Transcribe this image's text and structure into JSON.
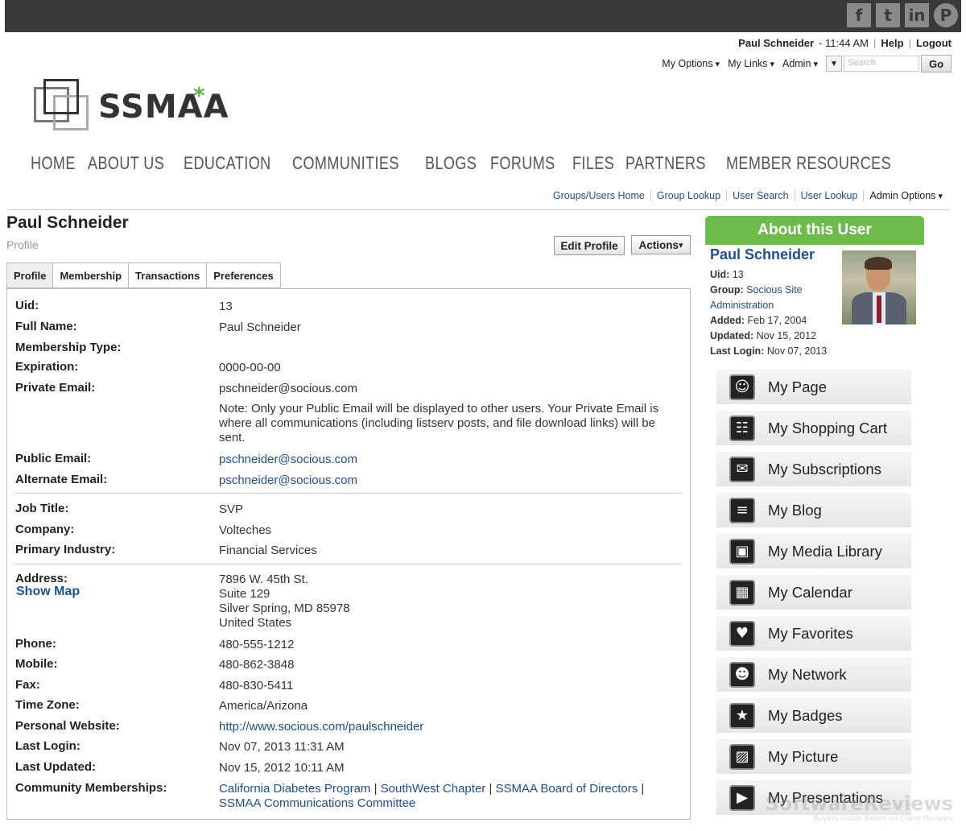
{
  "social": [
    {
      "icon": "facebook-icon",
      "glyph": "f"
    },
    {
      "icon": "twitter-icon",
      "glyph": "t"
    },
    {
      "icon": "linkedin-icon",
      "glyph": "in"
    },
    {
      "icon": "pinterest-icon",
      "glyph": "P"
    }
  ],
  "header": {
    "user_name": "Paul Schneider",
    "time": "- 11:44 AM",
    "help": "Help",
    "logout": "Logout",
    "my_options": "My Options",
    "my_links": "My Links",
    "admin": "Admin",
    "search_placeholder": "Search",
    "go": "Go"
  },
  "logo": {
    "text": "SSMAA",
    "star": "*"
  },
  "nav": [
    "HOME",
    "ABOUT US",
    "EDUCATION",
    "COMMUNITIES",
    "BLOGS",
    "FORUMS",
    "FILES",
    "PARTNERS",
    "MEMBER RESOURCES"
  ],
  "subnav": [
    "Groups/Users Home",
    "Group Lookup",
    "User Search",
    "User Lookup",
    "Admin Options"
  ],
  "page": {
    "title": "Paul Schneider",
    "subtitle": "Profile",
    "edit_profile": "Edit Profile",
    "actions": "Actions"
  },
  "tabs": [
    "Profile",
    "Membership",
    "Transactions",
    "Preferences"
  ],
  "profile": {
    "uid_label": "Uid:",
    "uid": "13",
    "fullname_label": "Full Name:",
    "fullname": "Paul Schneider",
    "membership_label": "Membership Type:",
    "expiration_label": "Expiration:",
    "expiration": "0000-00-00",
    "private_email_label": "Private Email:",
    "private_email": "pschneider@socious.com",
    "note": "Note: Only your Public Email will be displayed to other users. Your Private Email is where all communications (including listserv posts, and file download links) will be sent.",
    "public_email_label": "Public Email:",
    "public_email": "pschneider@socious.com",
    "alt_email_label": "Alternate Email:",
    "alt_email": "pschneider@socious.com",
    "job_label": "Job Title:",
    "job": "SVP",
    "company_label": "Company:",
    "company": "Volteches",
    "industry_label": "Primary Industry:",
    "industry": "Financial Services",
    "address_label": "Address:",
    "show_map": "Show Map",
    "address": [
      "7896 W. 45th St.",
      "Suite 129",
      "Silver Spring, MD 85978",
      "United States"
    ],
    "phone_label": "Phone:",
    "phone": "480-555-1212",
    "mobile_label": "Mobile:",
    "mobile": "480-862-3848",
    "fax_label": "Fax:",
    "fax": "480-830-5411",
    "tz_label": "Time Zone:",
    "tz": "America/Arizona",
    "website_label": "Personal Website:",
    "website": "http://www.socious.com/paulschneider",
    "lastlogin_label": "Last Login:",
    "lastlogin": "Nov 07, 2013 11:31 AM",
    "lastupdated_label": "Last Updated:",
    "lastupdated": "Nov 15, 2012 10:11 AM",
    "communities_label": "Community Memberships:",
    "communities": [
      "California Diabetes Program",
      "SouthWest Chapter",
      "SSMAA Board of Directors",
      "SSMAA Communications Committee"
    ]
  },
  "about": {
    "heading": "About this User",
    "name": "Paul Schneider",
    "uid_label": "Uid:",
    "uid": "13",
    "group_label": "Group:",
    "group": "Socious Site Administration",
    "added_label": "Added:",
    "added": "Feb 17, 2004",
    "updated_label": "Updated:",
    "updated": "Nov 15, 2012",
    "lastlogin_label": "Last Login:",
    "lastlogin": "Nov 07, 2013"
  },
  "menu": [
    {
      "label": "My Page",
      "icon": "user-icon",
      "glyph": "☺"
    },
    {
      "label": "My Shopping Cart",
      "icon": "cart-icon",
      "glyph": "☷"
    },
    {
      "label": "My Subscriptions",
      "icon": "envelope-icon",
      "glyph": "✉"
    },
    {
      "label": "My Blog",
      "icon": "rss-icon",
      "glyph": "≡"
    },
    {
      "label": "My Media Library",
      "icon": "media-icon",
      "glyph": "▣"
    },
    {
      "label": "My Calendar",
      "icon": "calendar-icon",
      "glyph": "▦"
    },
    {
      "label": "My Favorites",
      "icon": "heart-icon",
      "glyph": "♥"
    },
    {
      "label": "My Network",
      "icon": "network-icon",
      "glyph": "☻"
    },
    {
      "label": "My Badges",
      "icon": "badge-icon",
      "glyph": "★"
    },
    {
      "label": "My Picture",
      "icon": "picture-icon",
      "glyph": "▨"
    },
    {
      "label": "My Presentations",
      "icon": "presentation-icon",
      "glyph": "▶"
    }
  ],
  "watermark": {
    "text": "SoftwareReviews",
    "sub": "Buyers Guide Based on Client Reviews"
  }
}
